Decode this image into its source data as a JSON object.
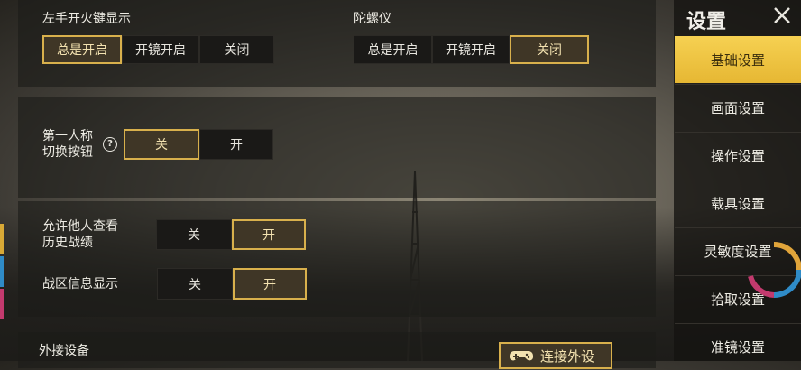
{
  "section1": {
    "left_fire_label": "左手开火键显示",
    "left_fire_options": [
      "总是开启",
      "开镜开启",
      "关闭"
    ],
    "left_fire_selected": 0,
    "gyro_label": "陀螺仪",
    "gyro_options": [
      "总是开启",
      "开镜开启",
      "关闭"
    ],
    "gyro_selected": 2
  },
  "section2": {
    "first_person_label": "第一人称\n切换按钮",
    "help_symbol": "?",
    "options": [
      "关",
      "开"
    ],
    "selected": 0
  },
  "section3": {
    "history_label": "允许他人查看\n历史战绩",
    "history_options": [
      "关",
      "开"
    ],
    "history_selected": 1,
    "region_label": "战区信息显示",
    "region_options": [
      "关",
      "开"
    ],
    "region_selected": 1
  },
  "section4": {
    "external_label": "外接设备",
    "connect_label": "连接外设"
  },
  "sidebar": {
    "title": "设置",
    "items": [
      {
        "label": "基础设置",
        "active": true
      },
      {
        "label": "画面设置",
        "active": false
      },
      {
        "label": "操作设置",
        "active": false
      },
      {
        "label": "载具设置",
        "active": false
      },
      {
        "label": "灵敏度设置",
        "active": false
      },
      {
        "label": "拾取设置",
        "active": false
      },
      {
        "label": "准镜设置",
        "active": false
      }
    ]
  },
  "colors": {
    "accent": "#d8b04c",
    "active_tab": "#f2c94c"
  },
  "icons": {
    "close": "close-icon",
    "help": "help-icon",
    "gamepad": "gamepad-icon"
  }
}
